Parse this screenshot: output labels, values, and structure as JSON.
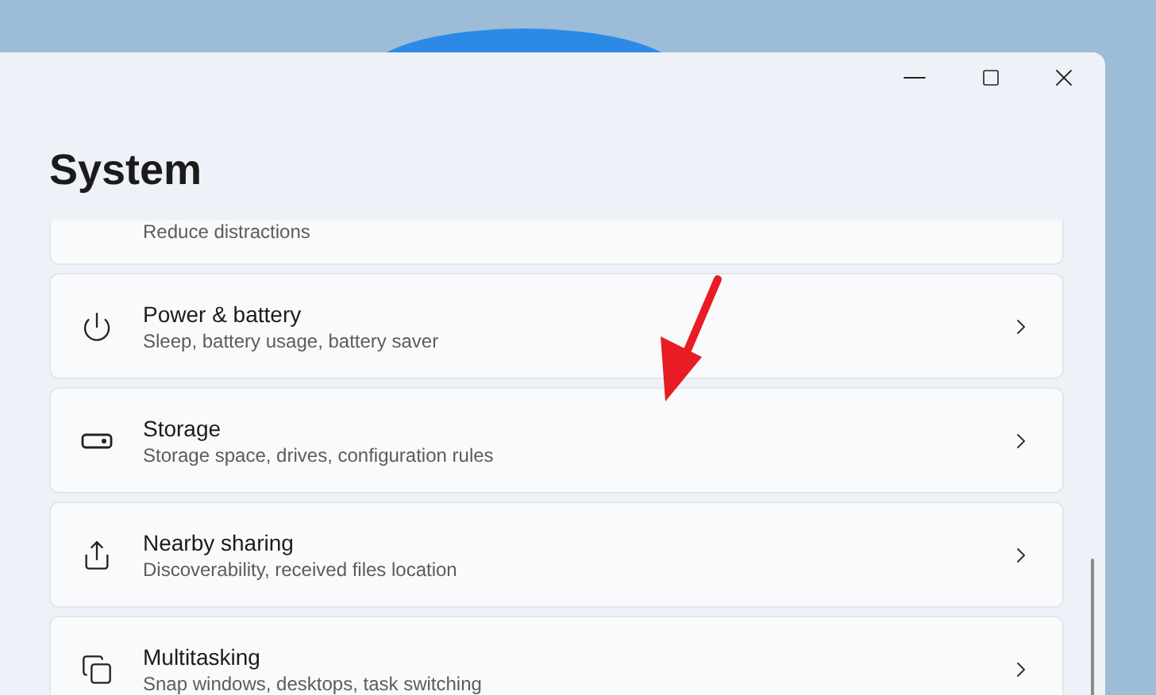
{
  "window": {
    "title": "System"
  },
  "items": [
    {
      "subtitle": "Reduce distractions"
    },
    {
      "title": "Power & battery",
      "subtitle": "Sleep, battery usage, battery saver"
    },
    {
      "title": "Storage",
      "subtitle": "Storage space, drives, configuration rules"
    },
    {
      "title": "Nearby sharing",
      "subtitle": "Discoverability, received files location"
    },
    {
      "title": "Multitasking",
      "subtitle": "Snap windows, desktops, task switching"
    }
  ]
}
